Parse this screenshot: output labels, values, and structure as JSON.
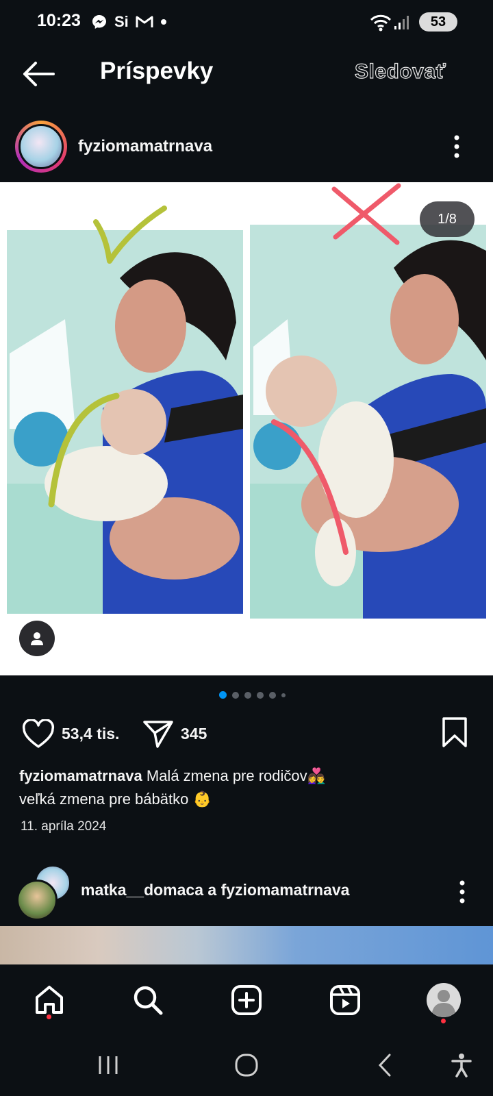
{
  "status": {
    "time": "10:23",
    "notification_icons": [
      "messenger-icon",
      "si-icon",
      "gmail-icon",
      "dot"
    ],
    "battery": "53"
  },
  "header": {
    "title": "Príspevky",
    "follow_label": "Sledovať"
  },
  "post": {
    "username": "fyziomamatrnava",
    "page_counter": "1/8",
    "carousel_total_dots": 6,
    "carousel_active_index": 0,
    "likes": "53,4 tis.",
    "shares": "345",
    "caption_user": "fyziomamatrnava",
    "caption_line1": "Malá zmena pre rodičov👩‍❤️‍👨",
    "caption_line2": "veľká zmena pre bábätko 👶",
    "date": "11. apríla 2024",
    "good_mark_color": "#b5c23a",
    "bad_mark_color": "#ef5a6a"
  },
  "next_post": {
    "users": "matka__domaca a fyziomamatrnava"
  },
  "colors": {
    "background": "#0c1014",
    "accent_blue": "#0095f6",
    "notification_red": "#ff3040"
  }
}
